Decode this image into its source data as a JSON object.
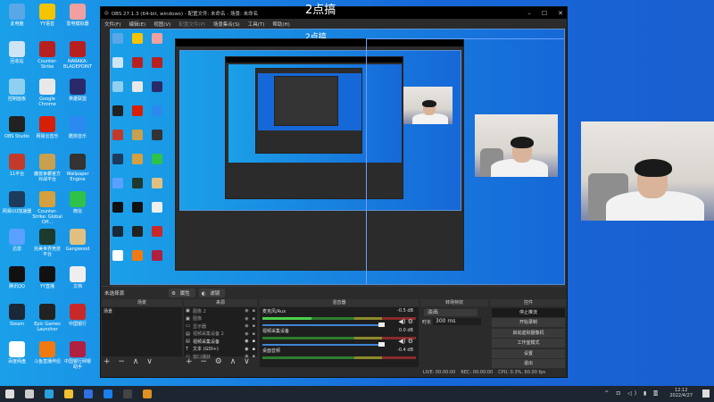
{
  "watermark": "2点搞",
  "desktop": {
    "icons": [
      {
        "label": "此电脑",
        "color": "#5aa7e8"
      },
      {
        "label": "回收站",
        "color": "#cfe4f5"
      },
      {
        "label": "控制面板",
        "color": "#8fd0f0"
      },
      {
        "label": "OBS Studio",
        "color": "#222"
      },
      {
        "label": "11平台",
        "color": "#c43a2a"
      },
      {
        "label": "网易UU加速器",
        "color": "#1d3b5a"
      },
      {
        "label": "迅雷",
        "color": "#5aa0ff"
      },
      {
        "label": "腾讯QQ",
        "color": "#111"
      },
      {
        "label": "Steam",
        "color": "#1b2838"
      },
      {
        "label": "百度网盘",
        "color": "#fff"
      },
      {
        "label": "YY语音",
        "color": "#f5c400"
      },
      {
        "label": "Counter-Strike",
        "color": "#b82020"
      },
      {
        "label": "Google Chrome",
        "color": "#e8e8e8"
      },
      {
        "label": "网易云音乐",
        "color": "#d81e06"
      },
      {
        "label": "魔兽争霸官方对战平台",
        "color": "#c8a050"
      },
      {
        "label": "Counter-Strike: Global Off...",
        "color": "#d4a040"
      },
      {
        "label": "完美世界竞技平台",
        "color": "#1e3a2e"
      },
      {
        "label": "YY直播",
        "color": "#111"
      },
      {
        "label": "Epic Games Launcher",
        "color": "#222"
      },
      {
        "label": "斗鱼直播伴侣",
        "color": "#f07a10"
      },
      {
        "label": "雷电模拟器",
        "color": "#f0a0a0"
      },
      {
        "label": "NARAKA: BLADEPOINT",
        "color": "#b82020"
      },
      {
        "label": "英雄联盟",
        "color": "#2a2a6a"
      },
      {
        "label": "酷狗音乐",
        "color": "#2a8af0"
      },
      {
        "label": "Wallpaper Engine",
        "color": "#333"
      },
      {
        "label": "微信",
        "color": "#2ec24a"
      },
      {
        "label": "Gangwood",
        "color": "#e0c080"
      },
      {
        "label": "文档",
        "color": "#eee"
      },
      {
        "label": "中国银行",
        "color": "#c82828"
      },
      {
        "label": "中国银行网银助手",
        "color": "#b02040"
      }
    ]
  },
  "obs": {
    "title": "OBS 27.1.3 (64-bit, windows) - 配置文件: 未命名 - 场景: 未命名",
    "window_controls": [
      "–",
      "☐",
      "✕"
    ],
    "menu": [
      "文件(F)",
      "编辑(E)",
      "视图(V)",
      "配置文件(P)",
      "场景集合(S)",
      "工具(T)",
      "帮助(H)"
    ],
    "preview_watermark": "2点搞",
    "context_bar": {
      "no_source": "未选择源",
      "properties": "属性",
      "filters": "滤镜"
    },
    "scenes": {
      "title": "场景",
      "items": [
        "场景"
      ],
      "tools": "+ − ∧ ∨"
    },
    "sources": {
      "title": "来源",
      "tools": "+ − ⚙ ∧ ∨",
      "items": [
        {
          "name": "图像 2",
          "icon": "image-icon"
        },
        {
          "name": "图像",
          "icon": "image-icon"
        },
        {
          "name": "显示器",
          "icon": "display-icon"
        },
        {
          "name": "视频采集设备 2",
          "icon": "camera-icon"
        },
        {
          "name": "视频采集设备",
          "icon": "camera-icon"
        },
        {
          "name": "文本 (GDI+)",
          "icon": "text-icon"
        },
        {
          "name": "窗口捕获",
          "icon": "window-icon"
        }
      ]
    },
    "mixer": {
      "title": "混音器",
      "channels": [
        {
          "name": "麦克风/Aux",
          "db": "-0.5 dB",
          "level": 0.32
        },
        {
          "name": "视频采集设备",
          "db": "0.0 dB",
          "level": 0
        },
        {
          "name": "桌面音频",
          "db": "-0.4 dB",
          "level": 0
        }
      ]
    },
    "transitions": {
      "title": "转场特效",
      "type": "淡出",
      "duration_label": "时长",
      "duration": "300 ms"
    },
    "controls": {
      "title": "控件",
      "buttons": [
        "停止推流",
        "开始录制",
        "启动虚拟摄像机",
        "工作室模式",
        "设置",
        "退出"
      ]
    },
    "status": {
      "live": "LIVE: 00:00:00",
      "rec": "REC: 00:00:00",
      "cpu": "CPU: 0.3%, 60.00 fps"
    }
  },
  "taskbar": {
    "apps": [
      "windows-icon",
      "search-icon",
      "edge-icon",
      "file-explorer-icon",
      "app-icon",
      "browser-icon",
      "obs-icon",
      "app2-icon"
    ],
    "time": "12:12",
    "date": "2022/4/27",
    "tray": "^ ⊡ ◁) ▮ 🀫"
  }
}
